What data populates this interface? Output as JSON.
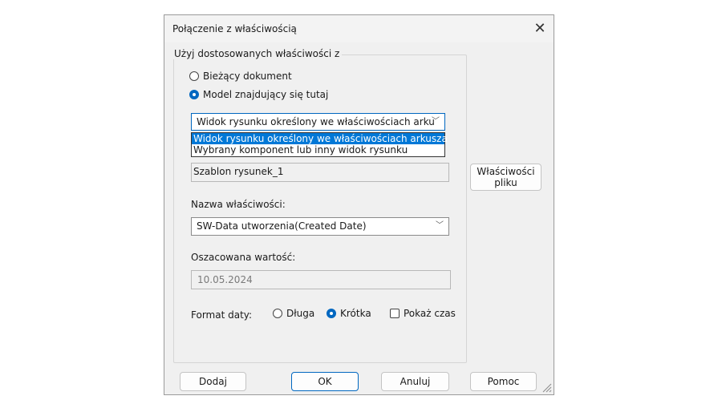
{
  "dialog": {
    "title": "Połączenie z właściwością",
    "close_glyph": "✕"
  },
  "group": {
    "label": "Użyj dostosowanych właściwości z",
    "radio_current": "Bieżący dokument",
    "radio_model": "Model znajdujący się tutaj"
  },
  "view_combo": {
    "value": "Widok rysunku określony we właściwościach arku",
    "options": [
      "Widok rysunku określony we właściwościach arkusza",
      "Wybrany komponent lub inny widok rysunku"
    ]
  },
  "template_field": {
    "value": "Szablon rysunek_1"
  },
  "file_props_button": {
    "line1": "Właściwości",
    "line2": "pliku"
  },
  "property": {
    "label": "Nazwa właściwości:",
    "value": "SW-Data utworzenia(Created Date)"
  },
  "estimate": {
    "label": "Oszacowana wartość:",
    "value": "10.05.2024"
  },
  "date_format": {
    "label": "Format daty:",
    "long": "Długa",
    "short": "Krótka",
    "show_time": "Pokaż czas"
  },
  "buttons": {
    "add": "Dodaj",
    "ok": "OK",
    "cancel": "Anuluj",
    "help": "Pomoc"
  },
  "colors": {
    "accent": "#0067c0",
    "selection": "#0078d7"
  }
}
